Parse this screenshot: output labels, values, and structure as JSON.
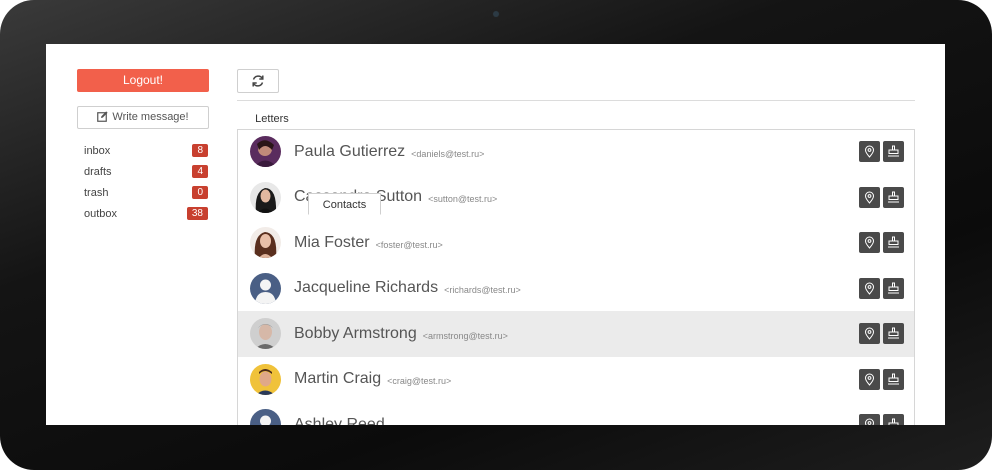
{
  "sidebar": {
    "logout_label": "Logout!",
    "write_label": "Write message!",
    "folders": [
      {
        "label": "inbox",
        "count": "8"
      },
      {
        "label": "drafts",
        "count": "4"
      },
      {
        "label": "trash",
        "count": "0"
      },
      {
        "label": "outbox",
        "count": "38"
      }
    ]
  },
  "tabs": [
    {
      "label": "Letters"
    },
    {
      "label": "Contacts"
    }
  ],
  "contacts": [
    {
      "name": "Paula Gutierrez",
      "email": "<daniels@test.ru>",
      "avatar": "photo-purple"
    },
    {
      "name": "Cassandra Sutton",
      "email": "<sutton@test.ru>",
      "avatar": "photo-dark-hair"
    },
    {
      "name": "Mia Foster",
      "email": "<foster@test.ru>",
      "avatar": "photo-brunette"
    },
    {
      "name": "Jacqueline Richards",
      "email": "<richards@test.ru>",
      "avatar": "default-silhouette"
    },
    {
      "name": "Bobby Armstrong",
      "email": "<armstrong@test.ru>",
      "avatar": "photo-gray"
    },
    {
      "name": "Martin Craig",
      "email": "<craig@test.ru>",
      "avatar": "photo-yellow"
    },
    {
      "name": "Ashley Reed",
      "email": "",
      "avatar": "default-silhouette"
    }
  ],
  "colors": {
    "accent": "#f2604b",
    "badge": "#c8402f",
    "action_button": "#4a4a4a",
    "selected_row": "#ebebeb"
  },
  "icons": {
    "refresh": "refresh-icon",
    "write": "edit-icon",
    "location": "location-pin-icon",
    "stamp": "stamp-icon"
  }
}
